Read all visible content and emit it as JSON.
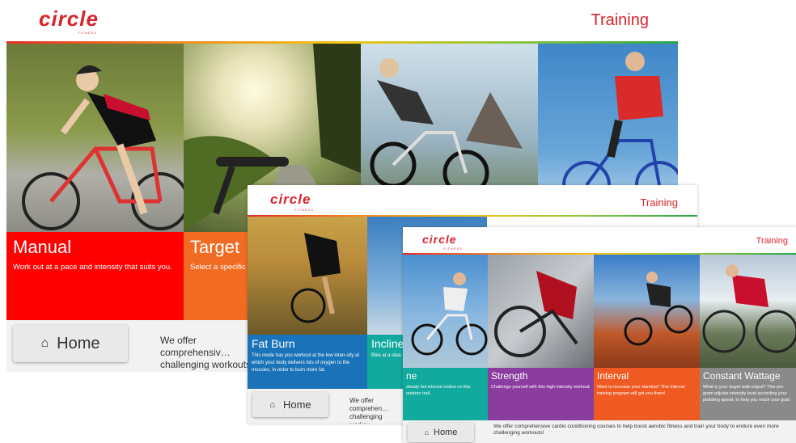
{
  "colors": {
    "brand_red": "#d9242b",
    "manual": "#ff0000",
    "target": "#f26b22",
    "fatburn": "#1a73b8",
    "incline": "#12a99e",
    "strength": "#8b3d9f",
    "interval": "#ef5a22",
    "constant": "#8a8a8a"
  },
  "back": {
    "logo": "circle",
    "logo_sub": "FITNESS",
    "title": "Training",
    "programs": [
      {
        "name": "Manual",
        "desc": "Work out at a pace and intensity that suits you."
      },
      {
        "name": "Target",
        "desc": "Select a specific t… You can do it!"
      }
    ],
    "home": "Home",
    "footer": "We offer comprehensiv… challenging workouts!"
  },
  "middle": {
    "logo": "circle",
    "logo_sub": "FITNESS",
    "title": "Training",
    "programs": [
      {
        "name": "Fat Burn",
        "desc": "This mode has you workout at the low inten-sity at which your body delivers lots of oxygen to the muscles, in order to burn more fat."
      },
      {
        "name": "Incline",
        "desc": "Bike at a stea… simulated out…"
      }
    ],
    "home": "Home",
    "footer": "We offer comprehen… challenging workou…"
  },
  "front": {
    "logo": "circle",
    "logo_sub": "FITNESS",
    "title": "Training",
    "programs": [
      {
        "name": "ne",
        "desc": "steady but intense incline on this outdoor trail."
      },
      {
        "name": "Strength",
        "desc": "Challenge yourself with this high intensity workout."
      },
      {
        "name": "Interval",
        "desc": "Want to increase your stamina? This interval training program will get you there!"
      },
      {
        "name": "Constant Wattage",
        "desc": "What is your target watt output? This pro-gram adjusts intensity level according your pedaling speed, to help you reach your goal."
      }
    ],
    "home": "Home",
    "footer": "We offer comprehensive cardio conditioning courses to help boost aerobic fitness and train your body to endure even more challenging workouts!"
  },
  "icons": {
    "home": "home-icon",
    "logo": "circle-logo"
  }
}
